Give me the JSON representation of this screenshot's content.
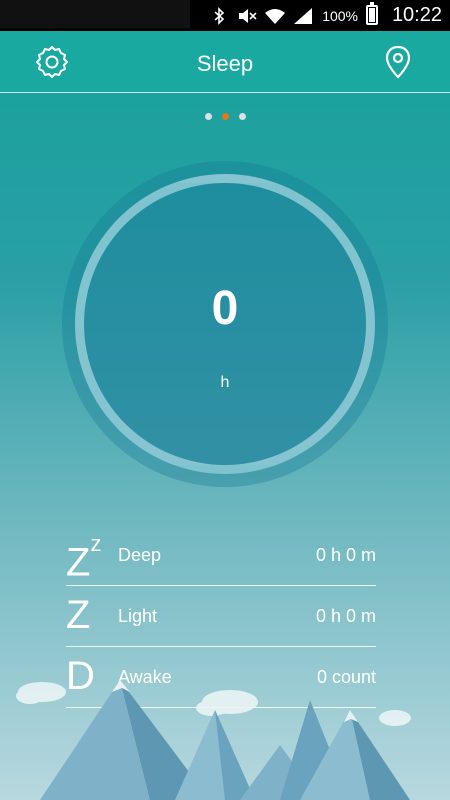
{
  "status_bar": {
    "battery_percent": "100%",
    "time": "10:22"
  },
  "app_bar": {
    "title": "Sleep",
    "left_icon": "settings-icon",
    "right_icon": "location-pin-icon"
  },
  "pager": {
    "count": 3,
    "active_index": 1,
    "active_color": "#e2761a"
  },
  "summary": {
    "value": "0",
    "unit": "h"
  },
  "stats": [
    {
      "label": "Deep",
      "value": "0 h 0 m",
      "icon": "deep-sleep-zz-icon"
    },
    {
      "label": "Light",
      "value": "0 h 0 m",
      "icon": "light-sleep-z-icon"
    },
    {
      "label": "Awake",
      "value": "0 count",
      "icon": "awake-d-icon"
    }
  ],
  "colors": {
    "app_bar": "#1aa9a0",
    "background_top": "#14a39a",
    "background_bottom": "#b8d8df"
  }
}
